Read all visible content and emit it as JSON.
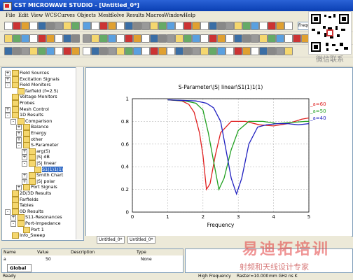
{
  "window": {
    "title": "CST MICROWAVE STUDIO - [Untitled_0*]"
  },
  "menu": [
    "File",
    "Edit",
    "View",
    "WCS",
    "Curves",
    "Objects",
    "Mesh",
    "Solve",
    "Results",
    "Macros",
    "Window",
    "Help"
  ],
  "toolbar": {
    "plane_label": "Frequ"
  },
  "watermark": {
    "qr_caption": "微信联系",
    "main": "易迪拓培训",
    "sub": "射频和天线设计专家"
  },
  "tree": {
    "items": [
      {
        "label": "Field Sources",
        "level": 0,
        "expand": "+"
      },
      {
        "label": "Excitation Signals",
        "level": 0,
        "expand": "+"
      },
      {
        "label": "Field Monitors",
        "level": 0,
        "expand": "-"
      },
      {
        "label": "farfield (f=2.5)",
        "level": 1,
        "expand": ""
      },
      {
        "label": "Voltage Monitors",
        "level": 0,
        "expand": ""
      },
      {
        "label": "Probes",
        "level": 0,
        "expand": ""
      },
      {
        "label": "Mesh Control",
        "level": 0,
        "expand": "+"
      },
      {
        "label": "1D Results",
        "level": 0,
        "expand": "-"
      },
      {
        "label": "Comparison",
        "level": 1,
        "expand": "-"
      },
      {
        "label": "Balance",
        "level": 2,
        "expand": "+"
      },
      {
        "label": "Energy",
        "level": 2,
        "expand": "+"
      },
      {
        "label": "other",
        "level": 2,
        "expand": "+"
      },
      {
        "label": "S-Parameter",
        "level": 2,
        "expand": "-"
      },
      {
        "label": "arg(S)",
        "level": 3,
        "expand": "+"
      },
      {
        "label": "|S| dB",
        "level": 3,
        "expand": "+"
      },
      {
        "label": "|S| linear",
        "level": 3,
        "expand": "-"
      },
      {
        "label": "S1(1)1(1)",
        "level": 4,
        "expand": ""
      },
      {
        "label": "Smith Chart",
        "level": 3,
        "expand": "+"
      },
      {
        "label": "|S| polar",
        "level": 3,
        "expand": "+"
      },
      {
        "label": "Port Signals",
        "level": 2,
        "expand": "+"
      },
      {
        "label": "2D/3D Results",
        "level": 0,
        "expand": ""
      },
      {
        "label": "Farfields",
        "level": 0,
        "expand": ""
      },
      {
        "label": "Tables",
        "level": 0,
        "expand": ""
      },
      {
        "label": "0D Results",
        "level": 0,
        "expand": "-"
      },
      {
        "label": "S11-Resonances",
        "level": 1,
        "expand": "+"
      },
      {
        "label": "Port-Impedance",
        "level": 1,
        "expand": "-"
      },
      {
        "label": "Port 1",
        "level": 2,
        "expand": ""
      },
      {
        "label": "Info_Sweep",
        "level": 0,
        "expand": ""
      }
    ]
  },
  "tabs": [
    "Untitled_0*",
    "Untitled_0*"
  ],
  "params": {
    "headers": [
      "Name",
      "Value",
      "Description",
      "Type"
    ],
    "row": [
      "a",
      "50",
      "",
      "None"
    ],
    "global_tab": "Global"
  },
  "status": {
    "left": "Ready",
    "mid": "High Frequency",
    "right": "Raster=10.000",
    "right2": "mm  GHz  ns  K"
  },
  "chart_data": {
    "type": "line",
    "title": "S-Parameter\\|S| linear\\S1(1)1(1)",
    "xlabel": "Frequency",
    "ylabel": "",
    "xlim": [
      0,
      5
    ],
    "ylim": [
      0,
      1
    ],
    "xticks": [
      0,
      1,
      2,
      3,
      4,
      5
    ],
    "yticks": [
      0,
      0.2,
      0.4,
      0.6,
      0.8,
      1
    ],
    "series": [
      {
        "name": "_a=60",
        "color": "#e02020",
        "x": [
          1,
          1.4,
          1.6,
          1.75,
          1.9,
          2.0,
          2.1,
          2.2,
          2.35,
          2.5,
          2.8,
          3.2,
          3.6,
          4.0,
          4.4,
          4.8,
          5.0
        ],
        "y": [
          0.99,
          0.98,
          0.95,
          0.88,
          0.7,
          0.5,
          0.2,
          0.25,
          0.5,
          0.7,
          0.8,
          0.8,
          0.77,
          0.76,
          0.78,
          0.82,
          0.83
        ]
      },
      {
        "name": "_a=50",
        "color": "#20a020",
        "x": [
          1,
          1.5,
          1.8,
          2.0,
          2.15,
          2.3,
          2.45,
          2.6,
          2.8,
          3.0,
          3.3,
          3.7,
          4.1,
          4.5,
          4.9,
          5.0
        ],
        "y": [
          0.99,
          0.98,
          0.96,
          0.9,
          0.7,
          0.45,
          0.2,
          0.3,
          0.55,
          0.72,
          0.8,
          0.8,
          0.78,
          0.79,
          0.8,
          0.8
        ]
      },
      {
        "name": "_a=40",
        "color": "#2020c0",
        "x": [
          1,
          1.8,
          2.1,
          2.3,
          2.5,
          2.65,
          2.8,
          2.95,
          3.1,
          3.3,
          3.55,
          3.8,
          4.1,
          4.4,
          4.7,
          5.0
        ],
        "y": [
          0.99,
          0.98,
          0.96,
          0.92,
          0.8,
          0.55,
          0.3,
          0.16,
          0.3,
          0.6,
          0.75,
          0.77,
          0.78,
          0.78,
          0.77,
          0.78
        ]
      }
    ]
  }
}
